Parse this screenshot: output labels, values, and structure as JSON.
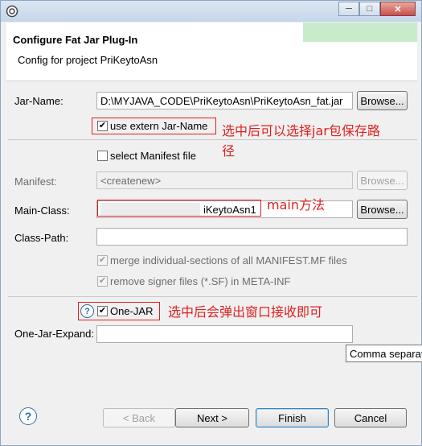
{
  "dialog": {
    "title": "Configure Fat Jar Plug-In",
    "subtitle": "Config for project PriKeytoAsn"
  },
  "window_controls": {
    "minimize": "─",
    "maximize": "□",
    "close": "✕"
  },
  "fields": {
    "jar_name": {
      "label": "Jar-Name:",
      "value": "D:\\MYJAVA_CODE\\PriKeytoAsn\\PriKeytoAsn_fat.jar",
      "browse": "Browse..."
    },
    "use_extern_jar_name": {
      "label": "use extern Jar-Name",
      "checked": true
    },
    "select_manifest": {
      "label": "select Manifest file",
      "checked": false
    },
    "manifest": {
      "label": "Manifest:",
      "value": "<createnew>",
      "browse": "Browse..."
    },
    "main_class": {
      "label": "Main-Class:",
      "value": "iKeytoAsn1",
      "browse": "Browse..."
    },
    "class_path": {
      "label": "Class-Path:",
      "value": ""
    },
    "merge_manifest": {
      "label": "merge individual-sections of all MANIFEST.MF files",
      "checked": true
    },
    "remove_signer": {
      "label": "remove signer files (*.SF) in META-INF",
      "checked": true
    },
    "one_jar": {
      "label": "One-JAR",
      "checked": true
    },
    "one_jar_expand": {
      "label": "One-Jar-Expand:",
      "value": ""
    }
  },
  "tooltip": "Comma separated",
  "annotations": {
    "jar_path_note_line1": "选中后可以选择jar包保存路",
    "jar_path_note_line2": "径",
    "main_note": "main方法",
    "one_jar_note": "选中后会弹出窗口接收即可"
  },
  "buttons": {
    "back": "< Back",
    "next": "Next >",
    "finish": "Finish",
    "cancel": "Cancel"
  },
  "icons": [
    "eclipse-app-icon",
    "help-icon",
    "checkbox-checked-icon"
  ],
  "colors": {
    "annotation_red": "#e02020",
    "banner_accent": "#c8eccb",
    "link_blue": "#2d6da3"
  }
}
